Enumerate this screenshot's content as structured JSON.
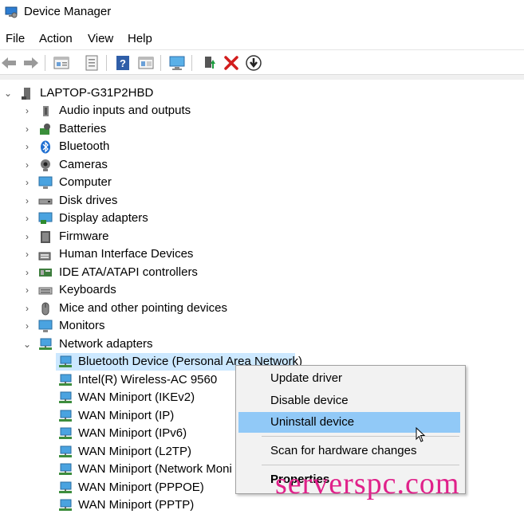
{
  "window": {
    "title": "Device Manager"
  },
  "menu": [
    "File",
    "Action",
    "View",
    "Help"
  ],
  "toolbar": {
    "buttons": [
      "back-icon",
      "forward-icon",
      "properties-icon",
      "update-driver-icon",
      "help-icon",
      "view-icon",
      "scan-icon",
      "enable-device-icon",
      "uninstall-icon",
      "download-icon"
    ]
  },
  "tree": {
    "root": "LAPTOP-G31P2HBD",
    "categories": [
      "Audio inputs and outputs",
      "Batteries",
      "Bluetooth",
      "Cameras",
      "Computer",
      "Disk drives",
      "Display adapters",
      "Firmware",
      "Human Interface Devices",
      "IDE ATA/ATAPI controllers",
      "Keyboards",
      "Mice and other pointing devices",
      "Monitors",
      "Network adapters"
    ],
    "network_devices": [
      "Bluetooth Device (Personal Area Network)",
      "Intel(R) Wireless-AC 9560",
      "WAN Miniport (IKEv2)",
      "WAN Miniport (IP)",
      "WAN Miniport (IPv6)",
      "WAN Miniport (L2TP)",
      "WAN Miniport (Network Moni",
      "WAN Miniport (PPPOE)",
      "WAN Miniport (PPTP)"
    ]
  },
  "context_menu": {
    "update": "Update driver",
    "disable": "Disable device",
    "uninstall": "Uninstall device",
    "scan": "Scan for hardware changes",
    "properties": "Properties"
  },
  "watermark": "serverspc.com",
  "colors": {
    "selection": "#cce8ff",
    "menu_highlight": "#91c9f7",
    "watermark": "#e0218a"
  }
}
